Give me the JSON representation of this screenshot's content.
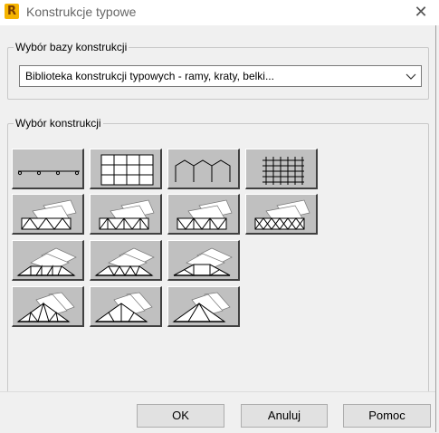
{
  "window": {
    "title": "Konstrukcje typowe",
    "app_icon_letter": "R",
    "close_glyph": "✕"
  },
  "base_group": {
    "label": "Wybór bazy konstrukcji",
    "dropdown_value": "Biblioteka konstrukcji typowych - ramy, kraty, belki..."
  },
  "structure_group": {
    "label": "Wybór konstrukcji",
    "tiles": [
      {
        "icon": "continuous-beam-icon"
      },
      {
        "icon": "frame-grid-icon"
      },
      {
        "icon": "multi-bay-portal-icon"
      },
      {
        "icon": "grillage-icon"
      },
      {
        "icon": "truss-3d-parallel-1-icon"
      },
      {
        "icon": "truss-3d-parallel-2-icon"
      },
      {
        "icon": "truss-3d-parallel-3-icon"
      },
      {
        "icon": "truss-3d-parallel-4-icon"
      },
      {
        "icon": "truss-3d-trapezoid-1-icon"
      },
      {
        "icon": "truss-3d-trapezoid-2-icon"
      },
      {
        "icon": "truss-3d-trapezoid-3-icon"
      },
      {
        "icon": "truss-3d-triangular-1-icon"
      },
      {
        "icon": "truss-3d-triangular-2-icon"
      },
      {
        "icon": "truss-3d-triangular-3-icon"
      }
    ]
  },
  "buttons": {
    "ok": "OK",
    "cancel": "Anuluj",
    "help": "Pomoc"
  }
}
